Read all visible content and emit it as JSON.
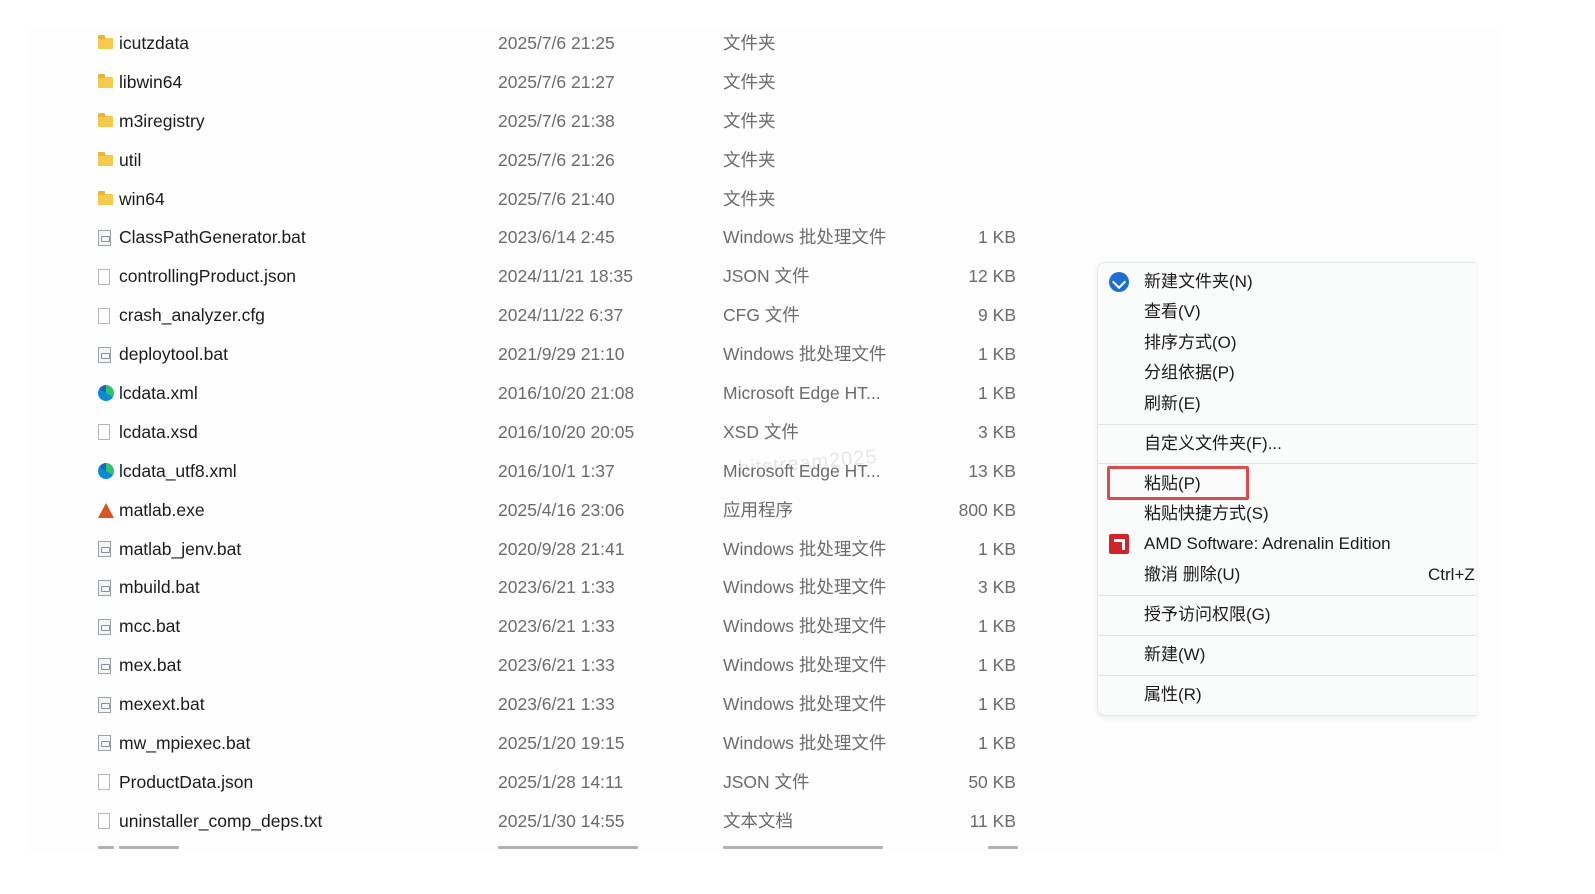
{
  "files": [
    {
      "icon": "folder-icon",
      "name": "icutzdata",
      "date": "2025/7/6 21:25",
      "type": "文件夹",
      "size": ""
    },
    {
      "icon": "folder-icon",
      "name": "libwin64",
      "date": "2025/7/6 21:27",
      "type": "文件夹",
      "size": ""
    },
    {
      "icon": "folder-icon",
      "name": "m3iregistry",
      "date": "2025/7/6 21:38",
      "type": "文件夹",
      "size": ""
    },
    {
      "icon": "folder-icon",
      "name": "util",
      "date": "2025/7/6 21:26",
      "type": "文件夹",
      "size": ""
    },
    {
      "icon": "folder-icon",
      "name": "win64",
      "date": "2025/7/6 21:40",
      "type": "文件夹",
      "size": ""
    },
    {
      "icon": "batch-file-icon",
      "name": "ClassPathGenerator.bat",
      "date": "2023/6/14 2:45",
      "type": "Windows 批处理文件",
      "size": "1 KB"
    },
    {
      "icon": "file-icon",
      "name": "controllingProduct.json",
      "date": "2024/11/21 18:35",
      "type": "JSON 文件",
      "size": "12 KB"
    },
    {
      "icon": "file-icon",
      "name": "crash_analyzer.cfg",
      "date": "2024/11/22 6:37",
      "type": "CFG 文件",
      "size": "9 KB"
    },
    {
      "icon": "batch-file-icon",
      "name": "deploytool.bat",
      "date": "2021/9/29 21:10",
      "type": "Windows 批处理文件",
      "size": "1 KB"
    },
    {
      "icon": "edge-icon",
      "name": "lcdata.xml",
      "date": "2016/10/20 21:08",
      "type": "Microsoft Edge HT...",
      "size": "1 KB"
    },
    {
      "icon": "file-icon",
      "name": "lcdata.xsd",
      "date": "2016/10/20 20:05",
      "type": "XSD 文件",
      "size": "3 KB"
    },
    {
      "icon": "edge-icon",
      "name": "lcdata_utf8.xml",
      "date": "2016/10/1 1:37",
      "type": "Microsoft Edge HT...",
      "size": "13 KB"
    },
    {
      "icon": "matlab-icon",
      "name": "matlab.exe",
      "date": "2025/4/16 23:06",
      "type": "应用程序",
      "size": "800 KB"
    },
    {
      "icon": "batch-file-icon",
      "name": "matlab_jenv.bat",
      "date": "2020/9/28 21:41",
      "type": "Windows 批处理文件",
      "size": "1 KB"
    },
    {
      "icon": "batch-file-icon",
      "name": "mbuild.bat",
      "date": "2023/6/21 1:33",
      "type": "Windows 批处理文件",
      "size": "3 KB"
    },
    {
      "icon": "batch-file-icon",
      "name": "mcc.bat",
      "date": "2023/6/21 1:33",
      "type": "Windows 批处理文件",
      "size": "1 KB"
    },
    {
      "icon": "batch-file-icon",
      "name": "mex.bat",
      "date": "2023/6/21 1:33",
      "type": "Windows 批处理文件",
      "size": "1 KB"
    },
    {
      "icon": "batch-file-icon",
      "name": "mexext.bat",
      "date": "2023/6/21 1:33",
      "type": "Windows 批处理文件",
      "size": "1 KB"
    },
    {
      "icon": "batch-file-icon",
      "name": "mw_mpiexec.bat",
      "date": "2025/1/20 19:15",
      "type": "Windows 批处理文件",
      "size": "1 KB"
    },
    {
      "icon": "file-icon",
      "name": "ProductData.json",
      "date": "2025/1/28 14:11",
      "type": "JSON 文件",
      "size": "50 KB"
    },
    {
      "icon": "file-icon",
      "name": "uninstaller_comp_deps.txt",
      "date": "2025/1/30 14:55",
      "type": "文本文档",
      "size": "11 KB"
    }
  ],
  "watermark": "bitstream2025",
  "context_menu": {
    "new_folder": "新建文件夹(N)",
    "view": "查看(V)",
    "sort_by": "排序方式(O)",
    "group_by": "分组依据(P)",
    "refresh": "刷新(E)",
    "customize_folder": "自定义文件夹(F)...",
    "paste": "粘贴(P)",
    "paste_shortcut": "粘贴快捷方式(S)",
    "amd_software": "AMD Software: Adrenalin Edition",
    "undo_delete": "撤消 删除(U)",
    "undo_shortcut": "Ctrl+Z",
    "give_access": "授予访问权限(G)",
    "new": "新建(W)",
    "properties": "属性(R)"
  },
  "colors": {
    "highlight_border": "#e04a4a",
    "folder": "#f5c94c",
    "amd_red": "#d2232a",
    "accent_blue": "#1f6fd1"
  }
}
